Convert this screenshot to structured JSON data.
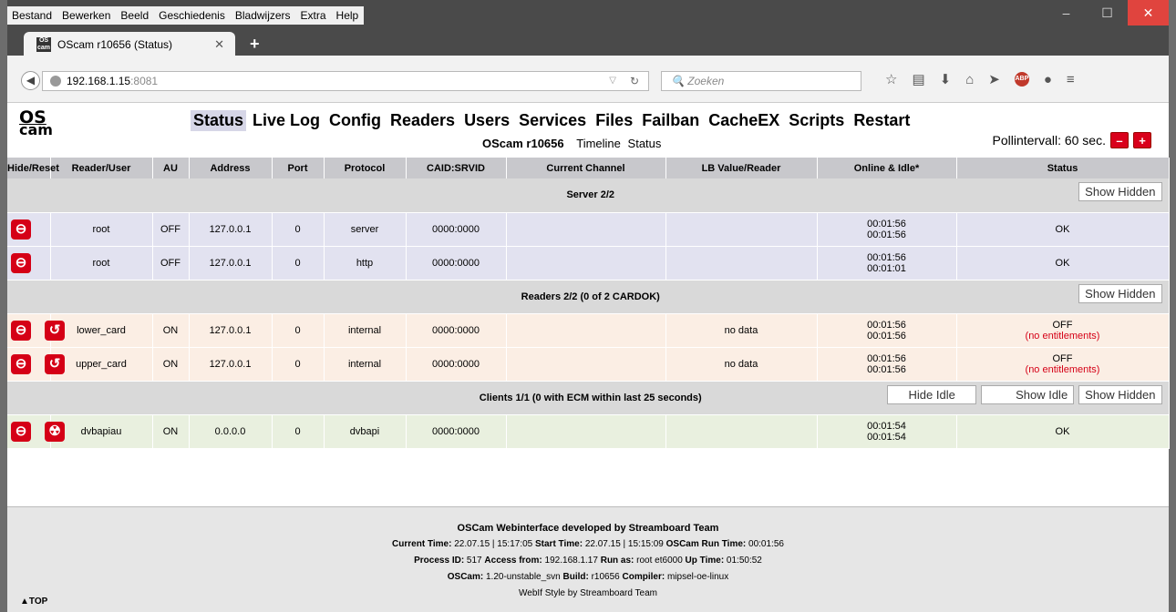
{
  "browser": {
    "menus": [
      "Bestand",
      "Bewerken",
      "Beeld",
      "Geschiedenis",
      "Bladwijzers",
      "Extra",
      "Help"
    ],
    "tab_title": "OScam r10656 (Status)",
    "tab_favicon": "OS cam",
    "url_host": "192.168.1.15",
    "url_port": ":8081",
    "search_placeholder": "Zoeken",
    "abp_label": "ABP"
  },
  "logo": {
    "line1": "OS",
    "line2": "cam"
  },
  "mainmenu": [
    "Status",
    "Live Log",
    "Config",
    "Readers",
    "Users",
    "Services",
    "Files",
    "Failban",
    "CacheEX",
    "Scripts",
    "Restart"
  ],
  "subline": {
    "version": "OScam r10656",
    "timeline": "Timeline",
    "status": "Status"
  },
  "poll": {
    "label": "Pollintervall: 60 sec.",
    "minus": "–",
    "plus": "+"
  },
  "columns": [
    "Hide/Reset",
    "Reader/User",
    "AU",
    "Address",
    "Port",
    "Protocol",
    "CAID:SRVID",
    "Current Channel",
    "LB Value/Reader",
    "Online & Idle*",
    "Status"
  ],
  "sections": {
    "server": {
      "title": "Server 2/2",
      "btn": "Show Hidden"
    },
    "readers": {
      "title": "Readers 2/2 (0 of 2 CARDOK)",
      "btn": "Show Hidden"
    },
    "clients": {
      "title": "Clients 1/1 (0 with ECM within last 25 seconds)",
      "btn_hide_idle": "Hide Idle",
      "btn_show_idle": "Show Idle",
      "btn": "Show Hidden"
    }
  },
  "server_rows": [
    {
      "name": "root",
      "au": "OFF",
      "address": "127.0.0.1",
      "port": "0",
      "protocol": "server",
      "caid": "0000:0000",
      "channel": "",
      "lb": "",
      "online": "00:01:56",
      "idle": "00:01:56",
      "status": "OK"
    },
    {
      "name": "root",
      "au": "OFF",
      "address": "127.0.0.1",
      "port": "0",
      "protocol": "http",
      "caid": "0000:0000",
      "channel": "",
      "lb": "",
      "online": "00:01:56",
      "idle": "00:01:01",
      "status": "OK"
    }
  ],
  "reader_rows": [
    {
      "name": "lower_card",
      "au": "ON",
      "address": "127.0.0.1",
      "port": "0",
      "protocol": "internal",
      "caid": "0000:0000",
      "channel": "",
      "lb": "no data",
      "online": "00:01:56",
      "idle": "00:01:56",
      "status": "OFF",
      "status_sub": "(no entitlements)"
    },
    {
      "name": "upper_card",
      "au": "ON",
      "address": "127.0.0.1",
      "port": "0",
      "protocol": "internal",
      "caid": "0000:0000",
      "channel": "",
      "lb": "no data",
      "online": "00:01:56",
      "idle": "00:01:56",
      "status": "OFF",
      "status_sub": "(no entitlements)"
    }
  ],
  "client_rows": [
    {
      "name": "dvbapiau",
      "au": "ON",
      "address": "0.0.0.0",
      "port": "0",
      "protocol": "dvbapi",
      "caid": "0000:0000",
      "channel": "",
      "lb": "",
      "online": "00:01:54",
      "idle": "00:01:54",
      "status": "OK"
    }
  ],
  "footer": {
    "heading": "OSCam Webinterface developed by Streamboard Team",
    "l1_k1": "Current Time:",
    "l1_v1": " 22.07.15 | 15:17:05 ",
    "l1_k2": "Start Time:",
    "l1_v2": " 22.07.15 | 15:15:09 ",
    "l1_k3": "OSCam Run Time:",
    "l1_v3": " 00:01:56",
    "l2_k1": "Process ID:",
    "l2_v1": " 517 ",
    "l2_k2": "Access from:",
    "l2_v2": " 192.168.1.17 ",
    "l2_k3": "Run as:",
    "l2_v3": " root et6000 ",
    "l2_k4": "Up Time:",
    "l2_v4": " 01:50:52",
    "l3_k1": "OSCam:",
    "l3_v1": " 1.20-unstable_svn ",
    "l3_k2": "Build:",
    "l3_v2": " r10656 ",
    "l3_k3": "Compiler:",
    "l3_v3": " mipsel-oe-linux",
    "style": "WebIf Style by Streamboard Team",
    "top": "▲TOP"
  },
  "colors": {
    "accent_red": "#d50016",
    "server_row": "#e2e2f0",
    "reader_row": "#fbeee4",
    "client_row": "#e9f0df"
  }
}
